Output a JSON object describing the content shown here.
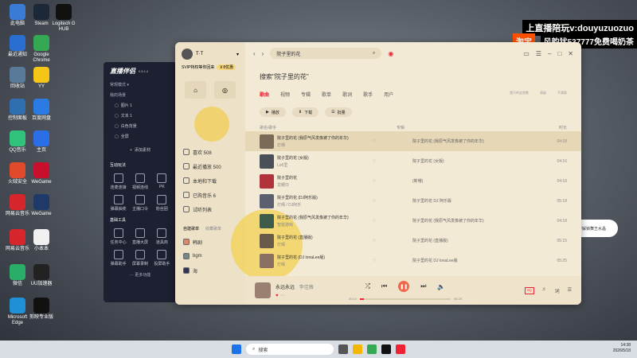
{
  "desktop": {
    "icons": [
      {
        "label": "此电脑",
        "color": "#3a7bd5"
      },
      {
        "label": "Steam",
        "color": "#1b2838"
      },
      {
        "label": "Logitech G HUB",
        "color": "#111111"
      },
      {
        "label": "最近通知",
        "color": "#2a6fd0"
      },
      {
        "label": "Google Chrome",
        "color": "#34a853"
      },
      {
        "label": "回收站",
        "color": "#5a7a9a"
      },
      {
        "label": "YY",
        "color": "#f5c518"
      },
      {
        "label": "控制面板",
        "color": "#2f6fb0"
      },
      {
        "label": "百度网盘",
        "color": "#2a7be4"
      },
      {
        "label": "QQ音乐",
        "color": "#31c27c"
      },
      {
        "label": "主页",
        "color": "#2a6fe8"
      },
      {
        "label": "火绒安全",
        "color": "#e04a2a"
      },
      {
        "label": "WeGame",
        "color": "#c8102e"
      },
      {
        "label": "网易云音乐",
        "color": "#d6262b"
      },
      {
        "label": "WeGame",
        "color": "#1f3a68"
      },
      {
        "label": "网易云音乐",
        "color": "#d6262b"
      },
      {
        "label": "小本本",
        "color": "#f0f0f0"
      },
      {
        "label": "微信",
        "color": "#2aae67"
      },
      {
        "label": "UU加速器",
        "color": "#222222"
      },
      {
        "label": "Microsoft Edge",
        "color": "#1f8fd6"
      },
      {
        "label": "剪映专业版",
        "color": "#111111"
      }
    ]
  },
  "overlay": {
    "line1": "上直播陪玩v:douyuzuozuo",
    "taobao": "淘宝",
    "line2": "风韵犹537777免费喝奶茶",
    "side_text": "必备技巧！打字解锁舞王水晶"
  },
  "streamer": {
    "title": "直播伴侣",
    "version": "6.5.1.2",
    "mode": "常规模式",
    "scene": "我的场景",
    "items": [
      "图片 1",
      "文本 1",
      "白色背景",
      "全屏"
    ],
    "add_material": "添加素材",
    "interact_title": "互动玩法",
    "interact": [
      "连麦连接",
      "视频连线",
      "PK",
      "弹幕抽奖",
      "主播口令",
      "粉丝团"
    ],
    "tools_title": "基础工具",
    "tools": [
      "任务中心",
      "直播大屏",
      "道具商",
      "弹幕助手",
      "屏幕录制",
      "投屏助手"
    ],
    "more": "更多功能"
  },
  "music": {
    "user": "T·T",
    "vip_text": "SVIP特权等你回来",
    "vip_badge": "￥8优惠",
    "side": [
      {
        "label": "喜欢 508"
      },
      {
        "label": "最近播放 500"
      },
      {
        "label": "本地和下载"
      },
      {
        "label": "已购音乐 6"
      },
      {
        "label": "试听列表"
      }
    ],
    "playlist_tabs": [
      "自建歌单",
      "收藏歌单"
    ],
    "playlists": [
      "韩剧",
      "bgm",
      "海"
    ],
    "search_value": "院子里的花",
    "search_title": "搜索\"院子里的花\"",
    "tabs": [
      "歌曲",
      "视频",
      "专辑",
      "歌单",
      "歌词",
      "歌手",
      "用户"
    ],
    "right_note": "我只听这首歌",
    "right_opts": [
      "高级",
      "不满意"
    ],
    "play_btn": "播放",
    "download_btn": "下载",
    "batch_btn": "批量",
    "col_song": "歌名/歌手",
    "col_album": "专辑",
    "col_time": "时长",
    "songs": [
      {
        "name": "院子里的花 (我原气风发像被了你的年华)",
        "artist": "灯晴",
        "album": "院子里的花 (我原气风发像被了你的年华)",
        "dur": "04:18",
        "sel": true,
        "cov": "#7a6a58"
      },
      {
        "name": "院子里的花 (女版)",
        "artist": "Lo6里",
        "album": "院子里的花 (女版)",
        "dur": "04:16",
        "sel": false,
        "cov": "#4a5058"
      },
      {
        "name": "院子里的花",
        "artist": "龙眼仔",
        "album": "(新哦)",
        "dur": "04:18",
        "sel": false,
        "cov": "#b0323a"
      },
      {
        "name": "院子里的花 (DJ阿乐版)",
        "artist": "灯晴 / DJ阿乐",
        "album": "院子里的花 DJ 阿乐版",
        "dur": "05:18",
        "sel": false,
        "cov": "#5a6070"
      },
      {
        "name": "院子里的花 (我原气风发像被了你的年华)",
        "artist": "智能游戏",
        "album": "院子里的花 (我原气风发像被了你的年华)",
        "dur": "04:18",
        "sel": false,
        "cov": "#3e5a48"
      },
      {
        "name": "院子里的花 (直播版)",
        "artist": "灯晴",
        "album": "院子里的花 (直播版)",
        "dur": "05:15",
        "sel": false,
        "cov": "#6a5a4a"
      },
      {
        "name": "院子里的花 (DJ lonaLee版)",
        "artist": "灯晴",
        "album": "院子里的花 DJ lonaLee版",
        "dur": "05:25",
        "sel": false,
        "cov": "#8a7060"
      }
    ],
    "player": {
      "title": "永远永远",
      "artist": "李佳薇",
      "time_cur": "00:10",
      "time_total": "05:25",
      "progress": 0.04
    }
  },
  "taskbar": {
    "search": "搜索",
    "time": "14:38",
    "date": "2026/5/18"
  }
}
